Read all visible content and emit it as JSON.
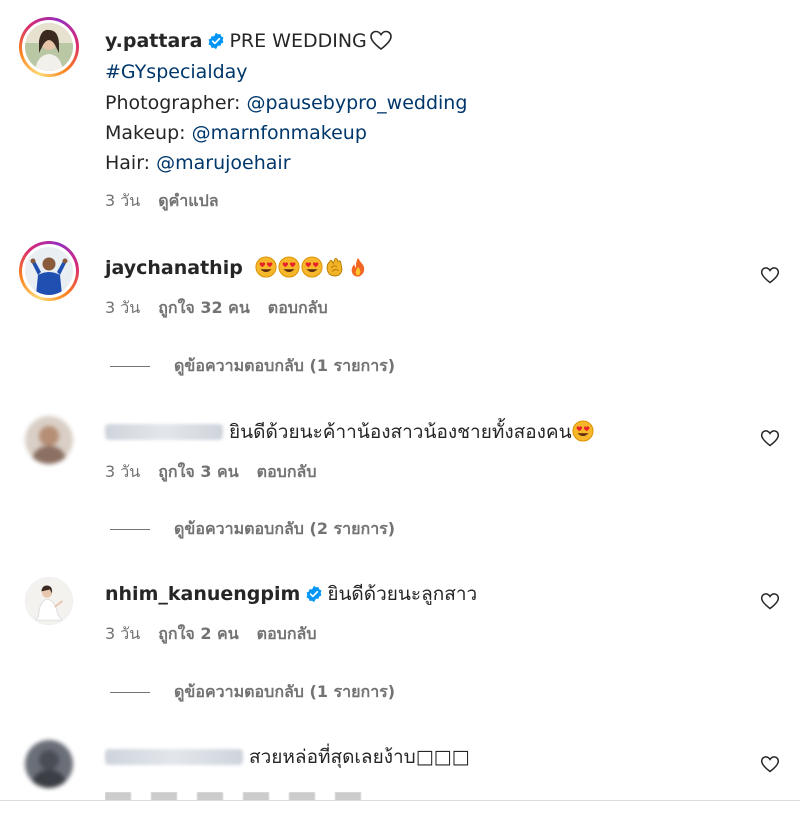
{
  "caption": {
    "username": "y.pattara",
    "title": "PRE WEDDING",
    "hashtag": "#GYspecialday",
    "photographer_label": "Photographer: ",
    "photographer": "@pausebypro_wedding",
    "makeup_label": "Makeup: ",
    "makeup": "@marnfonmakeup",
    "hair_label": "Hair: ",
    "hair": "@marujoehair",
    "time": "3 วัน",
    "translate": "ดูคำแปล"
  },
  "comments": [
    {
      "username": "jaychanathip",
      "emojis": [
        "heart-eyes",
        "heart-eyes",
        "heart-eyes",
        "clap",
        "fire"
      ],
      "time": "3 วัน",
      "likes": "ถูกใจ 32 คน",
      "reply": "ตอบกลับ",
      "view_replies": "ดูข้อความตอบกลับ (1 รายการ)"
    },
    {
      "username": "",
      "text": "ยินดีด้วยนะค้าาน้องสาวน้องชายทั้งสองคน",
      "time": "3 วัน",
      "likes": "ถูกใจ 3 คน",
      "reply": "ตอบกลับ",
      "view_replies": "ดูข้อความตอบกลับ (2 รายการ)"
    },
    {
      "username": "nhim_kanuengpim",
      "text": "ยินดีด้วยนะลูกสาว",
      "time": "3 วัน",
      "likes": "ถูกใจ 2 คน",
      "reply": "ตอบกลับ",
      "view_replies": "ดูข้อความตอบกลับ (1 รายการ)"
    },
    {
      "username": "",
      "text": "สวยหล่อที่สุดเลยง้าบ□□□"
    }
  ],
  "colors": {
    "link": "#00376b",
    "verified": "#0095f6",
    "muted": "#737373"
  }
}
